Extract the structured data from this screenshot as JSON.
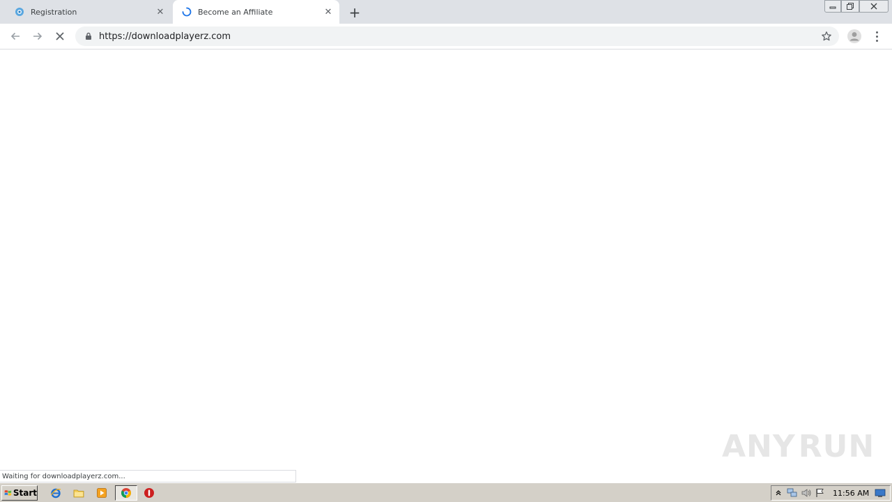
{
  "tabs": [
    {
      "title": "Registration",
      "icon": "registration-favicon",
      "active": false
    },
    {
      "title": "Become an Affiliate",
      "icon": "loading-spinner-icon",
      "active": true
    }
  ],
  "toolbar": {
    "url": "https://downloadplayerz.com"
  },
  "status": {
    "text": "Waiting for downloadplayerz.com..."
  },
  "watermark": {
    "left": "ANY",
    "right": "RUN"
  },
  "taskbar": {
    "start_label": "Start",
    "clock": "11:56 AM"
  },
  "colors": {
    "tabstrip": "#dee1e6",
    "omnibox": "#f1f3f4",
    "taskbar": "#d4d0c8",
    "spinner": "#1a73e8"
  }
}
